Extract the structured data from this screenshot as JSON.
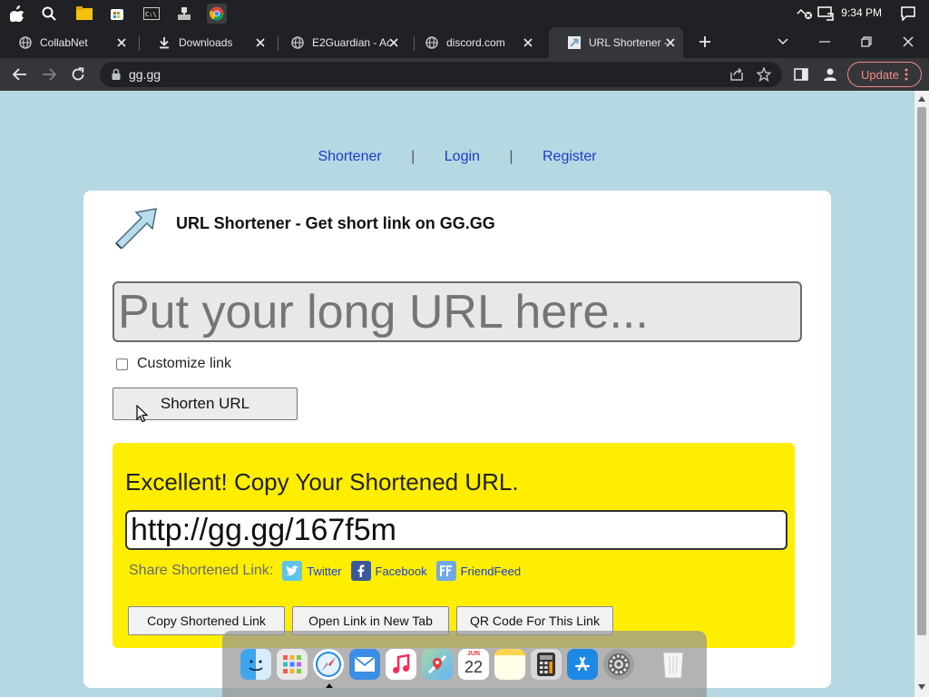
{
  "os": {
    "clock": "9:34 PM"
  },
  "browser": {
    "tabs": [
      {
        "title": "CollabNet",
        "icon": "globe-icon"
      },
      {
        "title": "Downloads",
        "icon": "download-icon"
      },
      {
        "title": "E2Guardian - Ac",
        "icon": "globe-icon"
      },
      {
        "title": "discord.com",
        "icon": "globe-icon"
      },
      {
        "title": "URL Shortener -",
        "icon": "site-favicon"
      }
    ],
    "url": "gg.gg",
    "update_label": "Update"
  },
  "page": {
    "nav": {
      "shortener": "Shortener",
      "login": "Login",
      "register": "Register",
      "separator": "|"
    },
    "title": "URL Shortener - Get short link on GG.GG",
    "long_url_placeholder": "Put your long URL here...",
    "customize_label": "Customize link",
    "shorten_label": "Shorten URL",
    "result": {
      "heading": "Excellent! Copy Your Shortened URL.",
      "short_url": "http://gg.gg/167f5m",
      "share_label": "Share Shortened Link:",
      "share_twitter": "Twitter",
      "share_facebook": "Facebook",
      "share_friendfeed": "FriendFeed",
      "copy_label": "Copy Shortened Link",
      "open_label": "Open Link in New Tab",
      "qr_label": "QR Code For This Link"
    }
  },
  "dock": {
    "items": [
      "finder-icon",
      "launchpad-icon",
      "safari-icon",
      "mail-icon",
      "music-icon",
      "maps-icon",
      "calendar-icon",
      "notes-icon",
      "calculator-icon",
      "app-store-icon",
      "system-settings-icon",
      "trash-icon"
    ],
    "calendar_month": "JUN",
    "calendar_day": "22"
  },
  "colors": {
    "page_bg": "#b5d8e3",
    "result_bg": "#ffee00",
    "link": "#1a3ec8",
    "update_accent": "#f28b82"
  }
}
